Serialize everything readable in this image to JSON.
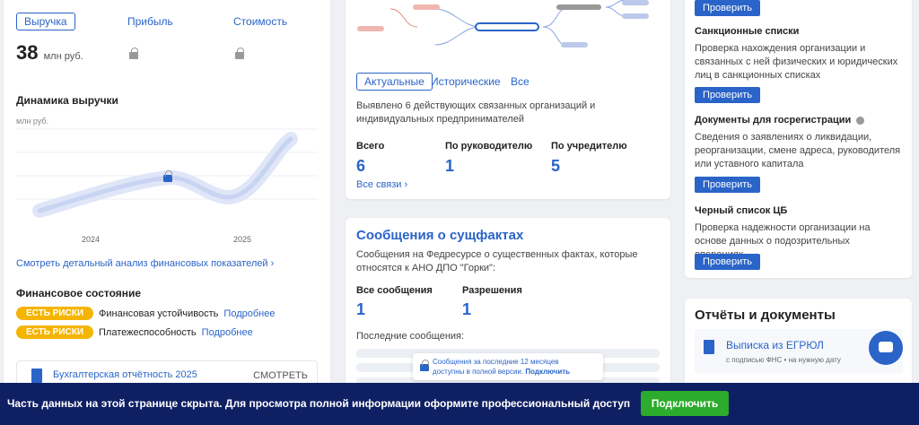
{
  "left": {
    "tabs": [
      "Выручка",
      "Прибыль",
      "Стоимость"
    ],
    "value": "38",
    "unit": "млн руб.",
    "dynamics_title": "Динамика выручки",
    "dynamics_unit": "млн руб.",
    "years": [
      "2024",
      "2025"
    ],
    "detail_link": "Смотреть детальный анализ финансовых показателей",
    "fin_state_title": "Финансовое состояние",
    "risk_badge": "ЕСТЬ РИСКИ",
    "risk_rows": [
      {
        "label": "Финансовая устойчивость",
        "link": "Подробнее"
      },
      {
        "label": "Платежеспособность",
        "link": "Подробнее"
      }
    ],
    "report_title": "Бухгалтерская отчётность 2025",
    "report_action": "СМОТРЕТЬ"
  },
  "mid_top": {
    "tabs": [
      "Актуальные",
      "Исторические",
      "Все"
    ],
    "desc": "Выявлено 6 действующих связанных организаций и индивидуальных предпринимателей",
    "stats": [
      {
        "label": "Всего",
        "value": "6"
      },
      {
        "label": "По руководителю",
        "value": "1"
      },
      {
        "label": "По учредителю",
        "value": "5"
      }
    ],
    "all_links": "Все связи"
  },
  "mid_bot": {
    "title": "Сообщения о сущфактах",
    "desc": "Сообщения на Федресурсе о существенных фактах, которые относятся к АНО ДПО \"Горки\":",
    "stats": [
      {
        "label": "Все сообщения",
        "value": "1"
      },
      {
        "label": "Разрешения",
        "value": "1"
      }
    ],
    "last_label": "Последние сообщения:",
    "lock_note_1": "Сообщения за последние 12 месяцев",
    "lock_note_2": "доступны в полной версии.",
    "lock_link": "Подключить"
  },
  "right": {
    "check": "Проверить",
    "sections": [
      {
        "title": "Санкционные списки",
        "text": "Проверка нахождения организации и связанных с ней физических и юридических лиц в санкционных списках"
      },
      {
        "title": "Документы для госрегистрации",
        "text": "Сведения о заявлениях о ликвидации, реорганизации, смене адреса, руководителя или уставного капитала"
      },
      {
        "title": "Черный список ЦБ",
        "text": "Проверка надежности организации на основе данных о подозрительных операциях"
      }
    ],
    "docs_title": "Отчёты и документы",
    "doc_name": "Выписка из ЕГРЮЛ",
    "doc_sub": "с подписью ФНС • на нужную дату"
  },
  "banner": {
    "text": "Часть данных на этой странице скрыта. Для просмотра полной информации оформите профессиональный доступ",
    "button": "Подключить"
  },
  "colors": {
    "accent": "#2a64c8",
    "risk": "#f5b400",
    "banner": "#0f1f63",
    "cta": "#2cab2c"
  }
}
